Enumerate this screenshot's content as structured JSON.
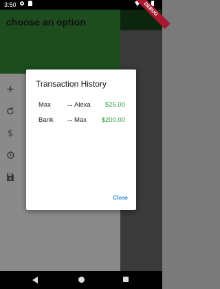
{
  "status": {
    "time": "3:50"
  },
  "debug_label": "DEBUG",
  "header": {
    "title": "choose an option"
  },
  "side_icons": [
    "add-icon",
    "refresh-icon",
    "dollar-icon",
    "history-icon",
    "save-icon"
  ],
  "dialog": {
    "title": "Transaction History",
    "transactions": [
      {
        "from": "Max",
        "arrow": "→",
        "to": "Alexa",
        "amount": "$25.00"
      },
      {
        "from": "Bank",
        "arrow": "→",
        "to": "Max",
        "amount": "$200.00"
      }
    ],
    "close_label": "Close"
  },
  "colors": {
    "header": "#1d4d1f",
    "amount": "#2e9d3b",
    "accent": "#2f8fd6"
  }
}
